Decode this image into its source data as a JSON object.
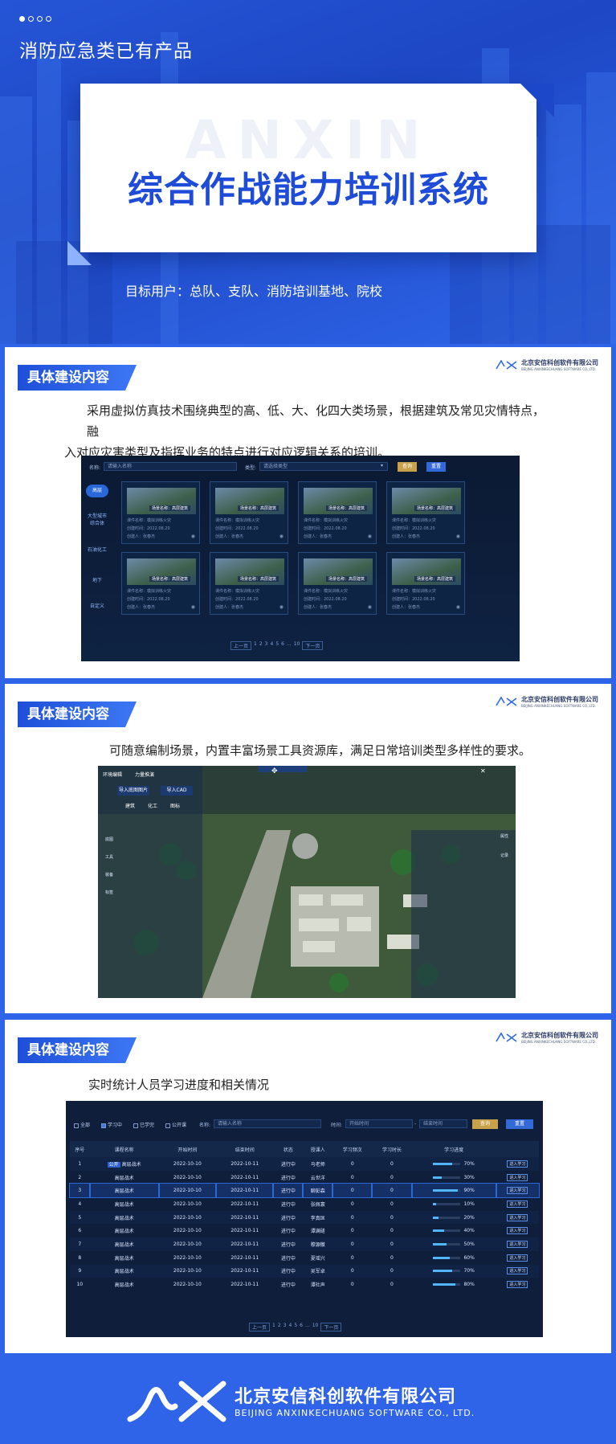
{
  "hero": {
    "category": "消防应急类已有产品",
    "watermark": "ANXIN",
    "title": "综合作战能力培训系统",
    "target_users": "目标用户：总队、支队、消防培训基地、院校"
  },
  "colors": {
    "primary": "#2f63e8",
    "title_blue": "#1e4cd8",
    "query_gold": "#c8a24a",
    "dark_panel": "#0f1e3a"
  },
  "brand": {
    "cn": "北京安信科创软件有限公司",
    "en": "BEIJING ANXINKECHUANG SOFTWARE CO.,LTD."
  },
  "section_tag": "具体建设内容",
  "sections": [
    {
      "desc_line1": "采用虚拟仿真技术围绕典型的高、低、大、化四大类场景，根据建筑及常见灾情特点，融",
      "desc_line2": "入对应灾害类型及指挥业务的特点进行对应逻辑关系的培训。"
    },
    {
      "desc": "可随意编制场景，内置丰富场景工具资源库，满足日常培训类型多样性的要求。"
    },
    {
      "desc": "实时统计人员学习进度和相关情况"
    }
  ],
  "screen1": {
    "name_label": "名称:",
    "name_placeholder": "请输入名称",
    "type_label": "类型:",
    "type_placeholder": "请选择类型",
    "query": "查询",
    "reset": "重置",
    "categories": [
      "高层",
      "大型城市综合体",
      "石油化工",
      "地下",
      "自定义"
    ],
    "card": {
      "thumb_label": "场景名称：高层建筑",
      "r1": "课件名称：模拟训练火灾",
      "r2": "创建时间：2022.08.20",
      "r3": "创建人：张春杰"
    },
    "pager": [
      "上一页",
      "1",
      "2",
      "3",
      "4",
      "5",
      "6",
      "...",
      "10",
      "下一页"
    ]
  },
  "screen2": {
    "tabs": [
      "环境编辑",
      "力量推演"
    ],
    "import_btns": [
      "导入底图图片",
      "导入CAD"
    ],
    "resource_tabs": [
      "建筑",
      "化工",
      "图标"
    ],
    "left_menu": [
      "底图",
      "工具",
      "装备",
      "标签"
    ],
    "right_menu": [
      "属性",
      "记录"
    ]
  },
  "screen3": {
    "filters": [
      "全部",
      "学习中",
      "已学完",
      "公开课"
    ],
    "name_label": "名称:",
    "name_placeholder": "请输入名称",
    "time_label": "时间:",
    "start_placeholder": "开始时间",
    "end_placeholder": "结束时间",
    "query": "查询",
    "reset": "重置",
    "headers": [
      "序号",
      "课程名称",
      "开始时间",
      "结束时间",
      "状态",
      "授课人",
      "学习频次",
      "学习时长",
      "学习进度",
      ""
    ],
    "public_badge": "公开",
    "enter_btn": "进入学习",
    "rows": [
      {
        "no": "1",
        "course": "高层战术",
        "start": "2022-10-10",
        "end": "2022-10-11",
        "status": "进行中",
        "teacher": "马老师",
        "freq": "0",
        "dur": "0",
        "progress": 70,
        "progress_text": "70%"
      },
      {
        "no": "2",
        "course": "高层战术",
        "start": "2022-10-10",
        "end": "2022-10-11",
        "status": "进行中",
        "teacher": "云世洋",
        "freq": "0",
        "dur": "0",
        "progress": 30,
        "progress_text": "30%"
      },
      {
        "no": "3",
        "course": "高层战术",
        "start": "2022-10-10",
        "end": "2022-10-11",
        "status": "进行中",
        "teacher": "聊彭森",
        "freq": "0",
        "dur": "0",
        "progress": 90,
        "progress_text": "90%"
      },
      {
        "no": "4",
        "course": "高层战术",
        "start": "2022-10-10",
        "end": "2022-10-11",
        "status": "进行中",
        "teacher": "张佩寰",
        "freq": "0",
        "dur": "0",
        "progress": 10,
        "progress_text": "10%"
      },
      {
        "no": "5",
        "course": "高层战术",
        "start": "2022-10-10",
        "end": "2022-10-11",
        "status": "进行中",
        "teacher": "李真匡",
        "freq": "0",
        "dur": "0",
        "progress": 20,
        "progress_text": "20%"
      },
      {
        "no": "6",
        "course": "高层战术",
        "start": "2022-10-10",
        "end": "2022-10-11",
        "status": "进行中",
        "teacher": "谭满磋",
        "freq": "0",
        "dur": "0",
        "progress": 40,
        "progress_text": "40%"
      },
      {
        "no": "7",
        "course": "高层战术",
        "start": "2022-10-10",
        "end": "2022-10-11",
        "status": "进行中",
        "teacher": "穆源徽",
        "freq": "0",
        "dur": "0",
        "progress": 50,
        "progress_text": "50%"
      },
      {
        "no": "8",
        "course": "高层战术",
        "start": "2022-10-10",
        "end": "2022-10-11",
        "status": "进行中",
        "teacher": "夏瑶兴",
        "freq": "0",
        "dur": "0",
        "progress": 60,
        "progress_text": "60%"
      },
      {
        "no": "9",
        "course": "高层战术",
        "start": "2022-10-10",
        "end": "2022-10-11",
        "status": "进行中",
        "teacher": "吴军卓",
        "freq": "0",
        "dur": "0",
        "progress": 70,
        "progress_text": "70%"
      },
      {
        "no": "10",
        "course": "高层战术",
        "start": "2022-10-10",
        "end": "2022-10-11",
        "status": "进行中",
        "teacher": "谭社声",
        "freq": "0",
        "dur": "0",
        "progress": 80,
        "progress_text": "80%"
      }
    ],
    "pager": [
      "上一页",
      "1",
      "2",
      "3",
      "4",
      "5",
      "6",
      "...",
      "10",
      "下一页"
    ]
  },
  "footer": {
    "cn": "北京安信科创软件有限公司",
    "en": "BEIJING ANXINKECHUANG SOFTWARE    CO., LTD."
  }
}
